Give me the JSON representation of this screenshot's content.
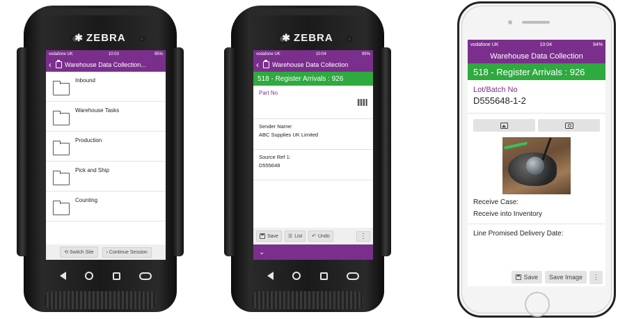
{
  "device1": {
    "brand": "ZEBRA",
    "status": {
      "carrier": "vodafone UK",
      "time": "10:03",
      "battery": "95%"
    },
    "title": "Warehouse Data Collection...",
    "folders": [
      {
        "label": "Inbound"
      },
      {
        "label": "Warehouse Tasks"
      },
      {
        "label": "Production"
      },
      {
        "label": "Pick and Ship"
      },
      {
        "label": "Counting"
      }
    ],
    "actions": {
      "switch_site": "Switch Site",
      "continue_session": "Continue Session"
    }
  },
  "device2": {
    "brand": "ZEBRA",
    "status": {
      "carrier": "vodafone UK",
      "time": "10:04",
      "battery": "95%"
    },
    "title": "Warehouse Data Collection",
    "green_title": "518 - Register Arrivals : 926",
    "part_no_label": "Part No",
    "sender_label": "Sender Name:",
    "sender_value": "ABC Supplies UK Limited",
    "source_label": "Source Ref 1:",
    "source_value": "D555648",
    "toolbar": {
      "save": "Save",
      "list": "List",
      "undo": "Undo"
    }
  },
  "iphone": {
    "status": {
      "carrier": "vodafone UK",
      "time": "10:04",
      "battery": "94%"
    },
    "title": "Warehouse Data Collection",
    "green_title": "518 - Register Arrivals : 926",
    "lot_label": "Lot/Batch No",
    "lot_value": "D555648-1-2",
    "receive_case_label": "Receive Case:",
    "receive_case_value": "Receive into Inventory",
    "delivery_label": "Line Promised Delivery Date:",
    "toolbar": {
      "save": "Save",
      "save_image": "Save Image"
    }
  },
  "colors": {
    "purple": "#7b2f8c",
    "green": "#2eaa3e"
  }
}
